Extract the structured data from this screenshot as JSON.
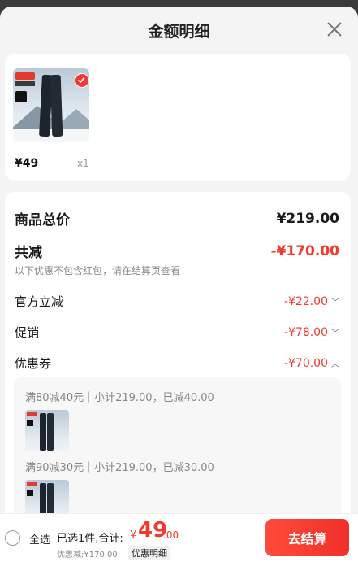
{
  "header": {
    "title": "金额明细"
  },
  "item": {
    "price": "¥49",
    "qty": "x1"
  },
  "summary": {
    "goods_total_label": "商品总价",
    "goods_total_value": "¥219.00",
    "reduce_label": "共减",
    "reduce_value": "-¥170.00",
    "reduce_note": "以下优惠不包含红包，请在结算页查看",
    "official_label": "官方立减",
    "official_value": "-¥22.00",
    "promo_label": "促销",
    "promo_value": "-¥78.00",
    "coupon_label": "优惠券",
    "coupon_value": "-¥70.00"
  },
  "coupons": [
    {
      "text": "满80减40元｜小计219.00，已减40.00"
    },
    {
      "text": "满90减30元｜小计219.00，已减30.00"
    }
  ],
  "footer": {
    "select_all": "全选",
    "selected_text": "已选1件,合计:",
    "total_prefix": "¥",
    "total_int": "49",
    "total_dec": ".00",
    "discount_text": "优惠减:¥170.00",
    "detail_link": "优惠明细",
    "checkout": "去结算"
  },
  "colors": {
    "accent": "#f03a2c",
    "background": "#f4f4f4"
  },
  "icons": {
    "close": "close-icon",
    "check": "check-icon",
    "chevron_down": "chevron-down-icon",
    "chevron_up": "chevron-up-icon"
  }
}
